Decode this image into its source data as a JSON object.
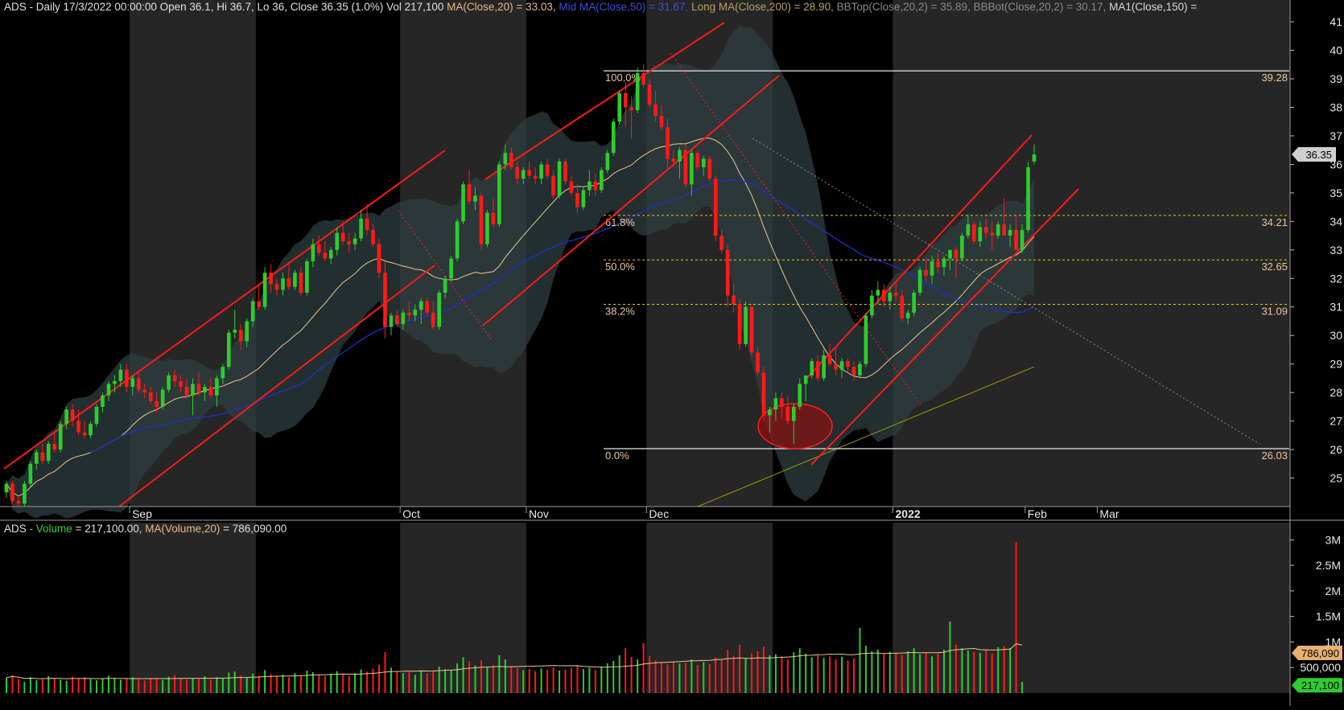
{
  "colors": {
    "background": "#000000",
    "band_alt": "#262626",
    "bb_cloud": "#2f3e40",
    "up": "#2ecc2e",
    "down": "#ff1a1a",
    "ma20": "#e8c890",
    "ma50": "#1e2fc8",
    "ma200": "#9aa000",
    "drawing": "#ff1a1a",
    "fib_line": "#e8e8e8",
    "fib_dash": "#e8c800",
    "label_text": "#e8c8a0"
  },
  "header": {
    "ticker": "ADS",
    "info": "- Daily 17/3/2022 00:00:00 Open 36.1, Hi 36.7, Lo 36, Close 36.35 (1.0%) Vol 217,100",
    "ma20": "MA(Close,20) = 33.03,",
    "ma50": "Mid MA(Close,50) = 31.67,",
    "ma200": "Long MA(Close,200) = 28.90,",
    "bbtop": "BBTop(Close,20,2) = 35.89,",
    "bbbot": "BBBot(Close,20,2) = 30.17,",
    "ma150": "MA1(Close,150) ="
  },
  "volume_header": {
    "ticker": "ADS",
    "vol_label": "- Volume",
    "vol_value": "= 217,100.00,",
    "ma_label": "MA(Volume,20)",
    "ma_value": "= 786,090.00"
  },
  "chart_data": {
    "type": "candlestick",
    "x_labels": [
      "Sep",
      "Oct",
      "Nov",
      "Dec",
      "2022",
      "Feb",
      "Mar"
    ],
    "y_ticks": [
      25,
      26,
      27,
      28,
      29,
      30,
      31,
      32,
      33,
      34,
      35,
      36,
      37,
      38,
      39,
      40,
      41
    ],
    "ylim": [
      24.0,
      41.2
    ],
    "last_price": "36.35",
    "fib_levels": [
      {
        "pct": "100.0%",
        "value": "39.28",
        "price": 39.28,
        "style": "solid"
      },
      {
        "pct": "61.8%",
        "value": "34.21",
        "price": 34.21,
        "style": "dashed"
      },
      {
        "pct": "50.0%",
        "value": "32.65",
        "price": 32.65,
        "style": "dashed"
      },
      {
        "pct": "38.2%",
        "value": "31.09",
        "price": 31.09,
        "style": "dashed"
      },
      {
        "pct": "0.0%",
        "value": "26.03",
        "price": 26.03,
        "style": "solid"
      }
    ],
    "candles": [
      [
        24.5,
        24.9,
        24.3,
        24.8
      ],
      [
        24.8,
        24.9,
        24.1,
        24.2
      ],
      [
        24.2,
        24.4,
        24.0,
        24.1
      ],
      [
        24.1,
        24.9,
        24.0,
        24.8
      ],
      [
        24.8,
        25.6,
        24.7,
        25.5
      ],
      [
        25.5,
        26.0,
        25.3,
        25.9
      ],
      [
        25.9,
        26.2,
        25.5,
        25.6
      ],
      [
        25.6,
        26.3,
        25.5,
        26.2
      ],
      [
        26.2,
        26.6,
        25.9,
        26.0
      ],
      [
        26.0,
        27.0,
        25.9,
        26.9
      ],
      [
        26.9,
        27.5,
        26.7,
        27.4
      ],
      [
        27.4,
        27.6,
        26.8,
        27.0
      ],
      [
        27.0,
        27.4,
        26.5,
        26.6
      ],
      [
        26.6,
        27.0,
        26.4,
        26.5
      ],
      [
        26.5,
        27.0,
        26.4,
        26.9
      ],
      [
        26.9,
        27.6,
        26.8,
        27.5
      ],
      [
        27.5,
        28.0,
        27.3,
        27.9
      ],
      [
        27.9,
        28.4,
        27.7,
        28.3
      ],
      [
        28.3,
        28.6,
        28.0,
        28.4
      ],
      [
        28.4,
        29.0,
        28.2,
        28.8
      ],
      [
        28.8,
        29.0,
        28.0,
        28.2
      ],
      [
        28.2,
        28.6,
        27.9,
        28.5
      ],
      [
        28.5,
        28.8,
        28.0,
        28.1
      ],
      [
        28.1,
        28.3,
        27.8,
        28.0
      ],
      [
        28.0,
        28.2,
        27.6,
        27.7
      ],
      [
        27.7,
        28.0,
        27.3,
        27.5
      ],
      [
        27.5,
        28.2,
        27.4,
        28.1
      ],
      [
        28.1,
        28.7,
        28.0,
        28.6
      ],
      [
        28.6,
        28.8,
        28.2,
        28.4
      ],
      [
        28.4,
        28.6,
        28.0,
        28.2
      ],
      [
        28.2,
        28.5,
        27.8,
        27.9
      ],
      [
        27.9,
        28.5,
        27.2,
        28.3
      ],
      [
        28.3,
        28.7,
        27.9,
        28.0
      ],
      [
        28.0,
        28.3,
        27.7,
        28.2
      ],
      [
        28.2,
        28.5,
        27.8,
        27.9
      ],
      [
        27.9,
        28.6,
        27.5,
        28.5
      ],
      [
        28.5,
        29.0,
        28.3,
        28.9
      ],
      [
        28.9,
        30.2,
        28.8,
        30.1
      ],
      [
        30.1,
        30.9,
        29.9,
        30.2
      ],
      [
        30.2,
        30.4,
        29.5,
        29.8
      ],
      [
        29.8,
        30.6,
        29.6,
        30.5
      ],
      [
        30.5,
        31.3,
        30.3,
        31.2
      ],
      [
        31.2,
        31.8,
        30.9,
        31.0
      ],
      [
        31.0,
        32.4,
        30.9,
        32.2
      ],
      [
        32.2,
        32.5,
        31.5,
        31.8
      ],
      [
        31.8,
        32.0,
        31.4,
        31.6
      ],
      [
        31.6,
        32.2,
        31.4,
        32.0
      ],
      [
        32.0,
        32.5,
        31.6,
        31.7
      ],
      [
        31.7,
        32.3,
        31.6,
        32.2
      ],
      [
        32.2,
        32.4,
        31.4,
        31.5
      ],
      [
        31.5,
        32.7,
        31.4,
        32.6
      ],
      [
        32.6,
        33.4,
        32.4,
        33.2
      ],
      [
        33.2,
        33.5,
        32.8,
        32.9
      ],
      [
        32.9,
        33.3,
        32.6,
        32.7
      ],
      [
        32.7,
        33.1,
        32.5,
        33.0
      ],
      [
        33.0,
        33.8,
        32.8,
        33.6
      ],
      [
        33.6,
        34.0,
        33.2,
        33.3
      ],
      [
        33.3,
        33.6,
        32.9,
        33.2
      ],
      [
        33.2,
        33.6,
        33.0,
        33.4
      ],
      [
        33.4,
        34.4,
        33.3,
        34.1
      ],
      [
        34.1,
        34.6,
        33.5,
        33.7
      ],
      [
        33.7,
        33.9,
        33.1,
        33.2
      ],
      [
        33.2,
        33.4,
        32.0,
        32.2
      ],
      [
        32.2,
        32.6,
        29.9,
        30.3
      ],
      [
        30.3,
        30.8,
        30.0,
        30.7
      ],
      [
        30.7,
        30.9,
        30.3,
        30.4
      ],
      [
        30.4,
        30.9,
        30.2,
        30.8
      ],
      [
        30.8,
        31.2,
        30.5,
        30.7
      ],
      [
        30.7,
        31.1,
        30.5,
        30.9
      ],
      [
        30.9,
        31.3,
        30.4,
        31.2
      ],
      [
        31.2,
        31.3,
        30.7,
        30.8
      ],
      [
        30.8,
        31.2,
        30.2,
        30.3
      ],
      [
        30.3,
        31.6,
        30.2,
        31.5
      ],
      [
        31.5,
        32.1,
        31.3,
        32.0
      ],
      [
        32.0,
        32.8,
        31.9,
        32.7
      ],
      [
        32.7,
        34.1,
        32.6,
        34.0
      ],
      [
        34.0,
        35.4,
        33.9,
        35.3
      ],
      [
        35.3,
        35.8,
        34.6,
        34.7
      ],
      [
        34.7,
        35.2,
        34.4,
        34.9
      ],
      [
        34.9,
        35.0,
        33.0,
        33.2
      ],
      [
        33.2,
        34.4,
        33.1,
        34.3
      ],
      [
        34.3,
        34.8,
        33.8,
        33.9
      ],
      [
        33.9,
        36.1,
        33.8,
        36.0
      ],
      [
        36.0,
        36.7,
        35.8,
        36.4
      ],
      [
        36.4,
        36.6,
        35.8,
        35.9
      ],
      [
        35.9,
        36.1,
        35.3,
        35.5
      ],
      [
        35.5,
        35.9,
        35.3,
        35.8
      ],
      [
        35.8,
        36.1,
        35.5,
        35.6
      ],
      [
        35.6,
        35.9,
        35.3,
        35.5
      ],
      [
        35.5,
        36.1,
        35.3,
        36.0
      ],
      [
        36.0,
        36.2,
        35.5,
        35.6
      ],
      [
        35.6,
        35.8,
        34.8,
        34.9
      ],
      [
        34.9,
        36.2,
        34.8,
        36.1
      ],
      [
        36.1,
        36.2,
        35.3,
        35.4
      ],
      [
        35.4,
        35.6,
        34.9,
        35.0
      ],
      [
        35.0,
        35.3,
        34.3,
        34.5
      ],
      [
        34.5,
        35.2,
        34.4,
        35.1
      ],
      [
        35.1,
        35.8,
        34.9,
        35.4
      ],
      [
        35.4,
        35.7,
        34.9,
        35.1
      ],
      [
        35.1,
        35.9,
        35.0,
        35.8
      ],
      [
        35.8,
        36.5,
        35.7,
        36.4
      ],
      [
        36.4,
        37.6,
        36.3,
        37.5
      ],
      [
        37.5,
        38.6,
        37.4,
        38.5
      ],
      [
        38.5,
        38.9,
        37.3,
        38.0
      ],
      [
        38.0,
        38.4,
        36.9,
        37.9
      ],
      [
        37.9,
        39.4,
        37.8,
        39.2
      ],
      [
        39.2,
        39.5,
        38.7,
        38.8
      ],
      [
        38.8,
        39.0,
        38.0,
        38.1
      ],
      [
        38.1,
        38.6,
        37.5,
        37.7
      ],
      [
        37.7,
        38.1,
        37.2,
        37.3
      ],
      [
        37.3,
        37.6,
        35.8,
        36.2
      ],
      [
        36.2,
        36.5,
        35.9,
        36.1
      ],
      [
        36.1,
        36.6,
        35.5,
        36.5
      ],
      [
        36.5,
        36.7,
        35.2,
        35.3
      ],
      [
        35.3,
        36.5,
        34.9,
        36.4
      ],
      [
        36.4,
        36.5,
        35.8,
        35.9
      ],
      [
        35.9,
        36.3,
        35.6,
        36.2
      ],
      [
        36.2,
        36.3,
        35.4,
        35.5
      ],
      [
        35.5,
        35.6,
        33.3,
        33.5
      ],
      [
        33.5,
        33.7,
        32.9,
        33.0
      ],
      [
        33.0,
        33.2,
        31.0,
        31.4
      ],
      [
        31.4,
        31.8,
        30.8,
        31.1
      ],
      [
        31.1,
        31.3,
        29.5,
        29.7
      ],
      [
        29.7,
        31.2,
        29.6,
        31.0
      ],
      [
        31.0,
        31.1,
        29.3,
        29.4
      ],
      [
        29.4,
        29.6,
        28.6,
        28.7
      ],
      [
        28.7,
        28.9,
        27.0,
        27.2
      ],
      [
        27.2,
        27.5,
        26.6,
        27.4
      ],
      [
        27.4,
        28.0,
        27.0,
        27.8
      ],
      [
        27.8,
        28.0,
        27.1,
        27.5
      ],
      [
        27.5,
        27.9,
        26.9,
        27.0
      ],
      [
        27.0,
        27.6,
        26.2,
        27.5
      ],
      [
        27.5,
        28.5,
        27.4,
        28.3
      ],
      [
        28.3,
        28.6,
        27.7,
        28.6
      ],
      [
        28.6,
        29.2,
        28.5,
        29.1
      ],
      [
        29.1,
        29.3,
        28.4,
        28.5
      ],
      [
        28.5,
        29.5,
        28.4,
        29.3
      ],
      [
        29.3,
        29.7,
        28.9,
        29.0
      ],
      [
        29.0,
        29.6,
        28.6,
        28.8
      ],
      [
        28.8,
        29.2,
        28.5,
        29.1
      ],
      [
        29.1,
        29.2,
        28.7,
        28.9
      ],
      [
        28.9,
        29.1,
        28.4,
        28.6
      ],
      [
        28.6,
        29.1,
        28.5,
        29.0
      ],
      [
        29.0,
        30.8,
        28.9,
        30.7
      ],
      [
        30.7,
        31.6,
        30.6,
        31.4
      ],
      [
        31.4,
        31.9,
        31.1,
        31.6
      ],
      [
        31.6,
        31.8,
        31.0,
        31.2
      ],
      [
        31.2,
        31.7,
        30.9,
        31.5
      ],
      [
        31.5,
        31.9,
        31.2,
        31.4
      ],
      [
        31.4,
        31.6,
        30.5,
        30.6
      ],
      [
        30.6,
        30.9,
        30.4,
        30.8
      ],
      [
        30.8,
        31.6,
        30.7,
        31.5
      ],
      [
        31.5,
        32.4,
        31.4,
        32.3
      ],
      [
        32.3,
        32.7,
        31.9,
        32.1
      ],
      [
        32.1,
        32.8,
        31.8,
        32.6
      ],
      [
        32.6,
        32.9,
        32.2,
        32.4
      ],
      [
        32.4,
        32.8,
        32.1,
        32.7
      ],
      [
        32.7,
        33.0,
        32.3,
        33.0
      ],
      [
        33.0,
        33.1,
        32.0,
        32.7
      ],
      [
        32.7,
        33.6,
        32.6,
        33.5
      ],
      [
        33.5,
        34.2,
        33.4,
        33.9
      ],
      [
        33.9,
        34.0,
        33.2,
        33.3
      ],
      [
        33.3,
        34.0,
        33.1,
        33.8
      ],
      [
        33.8,
        34.1,
        33.4,
        33.6
      ],
      [
        33.6,
        34.0,
        33.0,
        33.5
      ],
      [
        33.5,
        34.0,
        33.4,
        33.9
      ],
      [
        33.9,
        34.8,
        33.7,
        33.5
      ],
      [
        33.5,
        33.9,
        33.1,
        33.7
      ],
      [
        33.7,
        34.2,
        33.6,
        33.0
      ],
      [
        33.0,
        33.9,
        32.9,
        33.7
      ],
      [
        33.7,
        36.1,
        33.6,
        35.9
      ],
      [
        36.1,
        36.7,
        36.0,
        36.35
      ]
    ],
    "volumes": [
      0.3,
      0.35,
      0.28,
      0.22,
      0.31,
      0.25,
      0.27,
      0.33,
      0.29,
      0.26,
      0.24,
      0.32,
      0.28,
      0.31,
      0.27,
      0.25,
      0.29,
      0.34,
      0.3,
      0.26,
      0.28,
      0.31,
      0.27,
      0.25,
      0.3,
      0.28,
      0.26,
      0.32,
      0.35,
      0.29,
      0.27,
      0.3,
      0.28,
      0.33,
      0.26,
      0.31,
      0.29,
      0.4,
      0.42,
      0.35,
      0.31,
      0.38,
      0.34,
      0.45,
      0.37,
      0.33,
      0.36,
      0.31,
      0.39,
      0.35,
      0.44,
      0.41,
      0.36,
      0.33,
      0.38,
      0.43,
      0.37,
      0.34,
      0.39,
      0.46,
      0.42,
      0.48,
      0.55,
      0.8,
      0.5,
      0.42,
      0.39,
      0.41,
      0.36,
      0.44,
      0.38,
      0.43,
      0.52,
      0.47,
      0.45,
      0.58,
      0.7,
      0.62,
      0.54,
      0.64,
      0.51,
      0.55,
      0.74,
      0.66,
      0.52,
      0.49,
      0.45,
      0.47,
      0.43,
      0.48,
      0.46,
      0.5,
      0.44,
      0.46,
      0.49,
      0.55,
      0.47,
      0.5,
      0.45,
      0.52,
      0.58,
      0.63,
      0.74,
      0.88,
      0.71,
      0.66,
      0.98,
      0.72,
      0.64,
      0.6,
      0.56,
      0.62,
      0.58,
      0.59,
      0.66,
      0.55,
      0.61,
      0.57,
      0.7,
      0.65,
      0.85,
      0.72,
      0.95,
      0.68,
      0.78,
      0.82,
      0.91,
      0.74,
      0.76,
      0.72,
      0.66,
      0.8,
      0.88,
      0.77,
      0.7,
      0.74,
      0.69,
      0.72,
      0.66,
      0.71,
      0.64,
      0.68,
      1.28,
      0.93,
      0.82,
      0.85,
      0.77,
      0.81,
      0.79,
      0.74,
      0.82,
      0.88,
      0.76,
      0.8,
      0.72,
      0.78,
      0.85,
      1.4,
      0.95,
      0.88,
      0.83,
      0.81,
      0.79,
      0.86,
      0.78,
      0.9,
      0.92,
      0.88,
      2.95,
      0.22
    ]
  },
  "volume_axis": {
    "ticks": [
      {
        "label": "3M",
        "v": 3000000
      },
      {
        "label": "2.5M",
        "v": 2500000
      },
      {
        "label": "2M",
        "v": 2000000
      },
      {
        "label": "1.5M",
        "v": 1500000
      },
      {
        "label": "1M",
        "v": 1000000
      },
      {
        "label": "500,000",
        "v": 500000
      }
    ],
    "ma_badge": "786,090",
    "vol_badge": "217,100"
  }
}
